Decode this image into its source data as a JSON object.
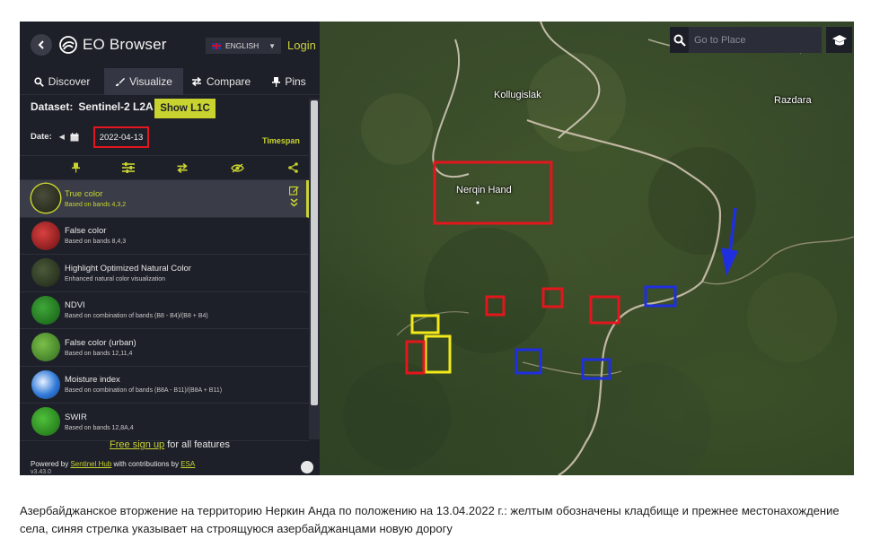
{
  "app": {
    "title": "EO Browser",
    "language": "ENGLISH",
    "login_label": "Login"
  },
  "tabs": [
    {
      "label": "Discover",
      "icon": "search-icon"
    },
    {
      "label": "Visualize",
      "icon": "brush-icon",
      "active": true
    },
    {
      "label": "Compare",
      "icon": "compare-icon"
    },
    {
      "label": "Pins",
      "icon": "pin-icon"
    }
  ],
  "dataset": {
    "label": "Dataset:",
    "value": "Sentinel-2 L2A",
    "show_button": "Show L1C"
  },
  "date": {
    "label": "Date:",
    "value": "2022-04-13",
    "timespan_label": "Timespan"
  },
  "toolbar_icons": [
    "pin-icon",
    "sliders-icon",
    "swap-icon",
    "eye-off-icon",
    "share-icon"
  ],
  "layers": [
    {
      "name": "True color",
      "desc": "Based on bands 4,3,2",
      "active": true
    },
    {
      "name": "False color",
      "desc": "Based on bands 8,4,3"
    },
    {
      "name": "Highlight Optimized Natural Color",
      "desc": "Enhanced natural color visualization"
    },
    {
      "name": "NDVI",
      "desc": "Based on combination of bands (B8 - B4)/(B8 + B4)"
    },
    {
      "name": "False color (urban)",
      "desc": "Based on bands 12,11,4"
    },
    {
      "name": "Moisture index",
      "desc": "Based on combination of bands (B8A - B11)/(B8A + B11)"
    },
    {
      "name": "SWIR",
      "desc": "Based on bands 12,8A,4"
    }
  ],
  "footer": {
    "signup_link": "Free sign up",
    "signup_rest": " for all features",
    "powered_prefix": "Powered by ",
    "powered_link": "Sentinel Hub",
    "contrib": " with contributions by ",
    "contrib_link": "ESA",
    "version": "v3.43.0"
  },
  "search": {
    "placeholder": "Go to Place"
  },
  "map_labels": {
    "kollugislak": "Kollugislak",
    "razdara": "Razdara",
    "nerqin_hand": "Nerqin Hand"
  },
  "colors": {
    "accent": "#c8d32f",
    "red_box": "#e3161d",
    "blue_box": "#1f2fe0",
    "yellow_box": "#f2e81a"
  },
  "caption": "Азербайджанское вторжение на территорию Неркин Анда по положению на 13.04.2022 г.: желтым обозначены кладбище и прежнее местонахождение села, синяя стрелка указывает на строящуюся азербайджанцами новую дорогу"
}
